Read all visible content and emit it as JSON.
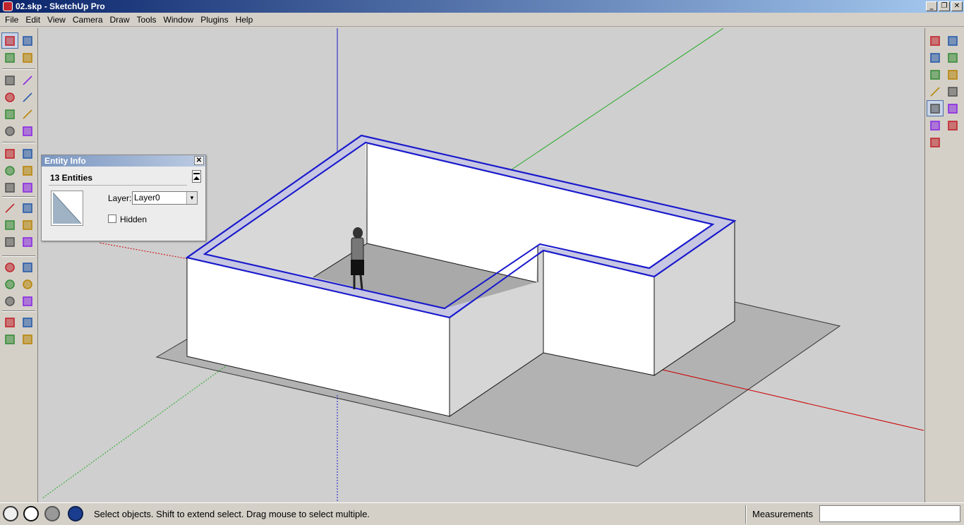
{
  "window": {
    "title": "02.skp - SketchUp Pro",
    "minimize_glyph": "_",
    "restore_glyph": "❐",
    "close_glyph": "✕"
  },
  "menu": [
    "File",
    "Edit",
    "View",
    "Camera",
    "Draw",
    "Tools",
    "Window",
    "Plugins",
    "Help"
  ],
  "left_toolbar": [
    [
      "select-icon",
      "make-component-icon"
    ],
    [
      "paint-bucket-icon",
      "eraser-icon"
    ],
    [
      "rectangle-icon",
      "line-icon"
    ],
    [
      "circle-icon",
      "arc-icon"
    ],
    [
      "polygon-icon",
      "freehand-icon"
    ],
    [
      "rotated-rectangle-icon",
      "pie-icon"
    ],
    [
      "move-icon",
      "push-pull-icon"
    ],
    [
      "rotate-icon",
      "follow-me-icon"
    ],
    [
      "scale-icon",
      "offset-icon"
    ],
    [
      "tape-measure-icon",
      "dimension-icon"
    ],
    [
      "protractor-icon",
      "text-icon"
    ],
    [
      "axes-icon",
      "3d-text-icon"
    ],
    [
      "orbit-icon",
      "pan-icon"
    ],
    [
      "zoom-icon",
      "zoom-window-icon"
    ],
    [
      "zoom-extents-icon",
      "previous-view-icon"
    ],
    [
      "position-camera-icon",
      "look-around-icon"
    ],
    [
      "walk-icon",
      "section-plane-icon"
    ]
  ],
  "right_toolbar": [
    [
      "xray-icon",
      "iso-view-icon"
    ],
    [
      "back-edges-icon",
      "top-view-icon"
    ],
    [
      "wireframe-icon",
      "front-view-icon"
    ],
    [
      "hidden-line-icon",
      "right-view-icon"
    ],
    [
      "shaded-icon",
      "back-view-icon"
    ],
    [
      "shaded-textures-icon",
      "left-view-icon"
    ],
    [
      "monochrome-icon",
      ""
    ]
  ],
  "entity_info": {
    "title": "Entity Info",
    "count": "13 Entities",
    "layer_label": "Layer:",
    "layer_value": "Layer0",
    "hidden_label": "Hidden",
    "close_glyph": "✕"
  },
  "status": {
    "message": "Select objects. Shift to extend select. Drag mouse to select multiple.",
    "measurements_label": "Measurements",
    "measurements_value": ""
  },
  "colors": {
    "selection_blue": "#1a1acc",
    "axis_red": "#cc0000",
    "axis_green": "#00aa00",
    "axis_blue": "#0000cc",
    "canvas_bg": "#cfcfcf",
    "wall_face": "#ffffff",
    "wall_side": "#d4d4d4",
    "floor": "#b4b4b4",
    "shadow": "#a8a8a8"
  }
}
